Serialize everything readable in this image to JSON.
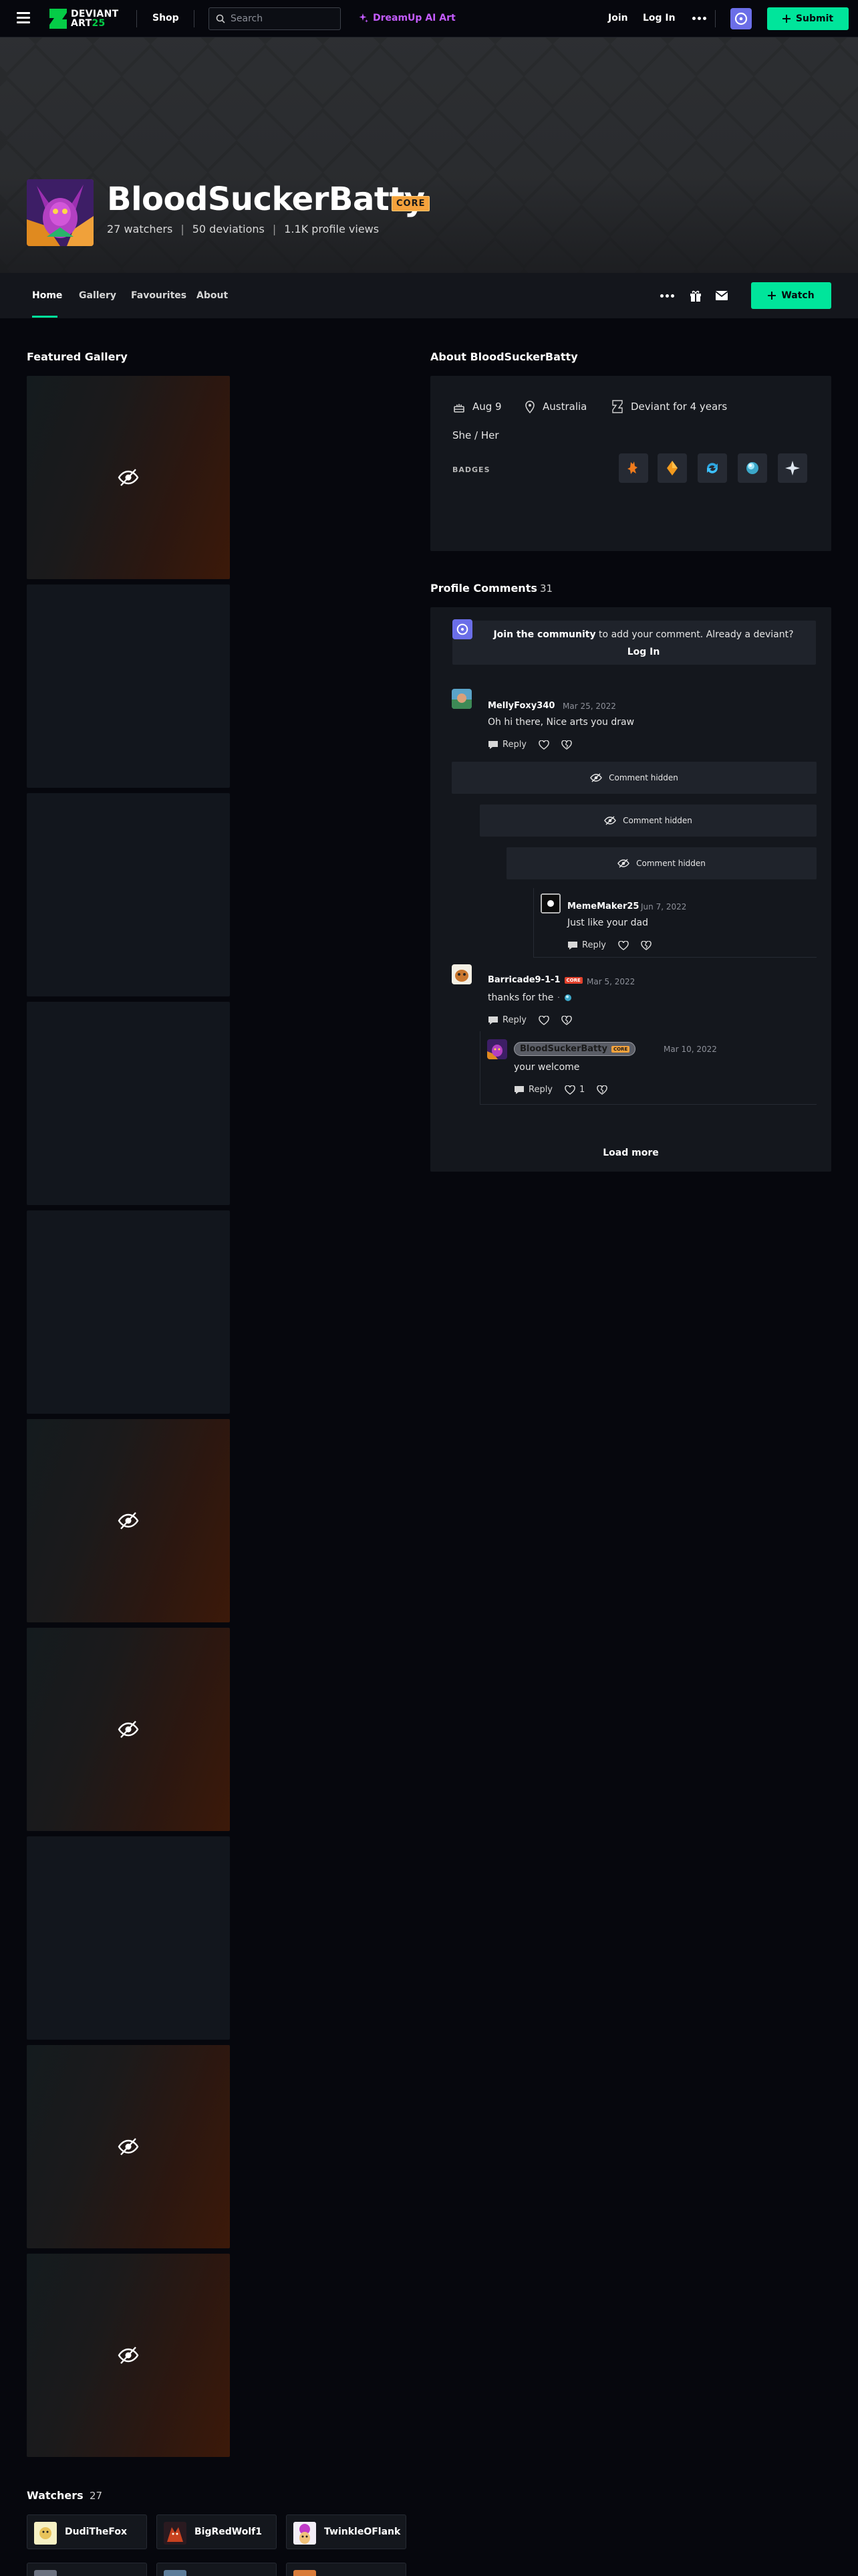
{
  "topnav": {
    "logo_line1": "DEVIANT",
    "logo_line2": "ART",
    "logo_year": "25",
    "shop": "Shop",
    "search_placeholder": "Search",
    "dreamup": "DreamUp AI Art",
    "join": "Join",
    "login": "Log In",
    "submit": "Submit"
  },
  "profile": {
    "username": "BloodSuckerBatty",
    "badge": "CORE",
    "watchers": "27 watchers",
    "deviations": "50 deviations",
    "views": "1.1K profile views"
  },
  "tabs": [
    {
      "label": "Home"
    },
    {
      "label": "Gallery"
    },
    {
      "label": "Favourites"
    },
    {
      "label": "About"
    }
  ],
  "watch_button": "Watch",
  "featured": {
    "title": "Featured Gallery",
    "thumbs": [
      "hidden",
      "plain",
      "plain",
      "plain",
      "plain",
      "hidden",
      "hidden",
      "plain",
      "hidden",
      "hidden"
    ]
  },
  "about": {
    "title": "About BloodSuckerBatty",
    "birthday": "Aug 9",
    "location": "Australia",
    "member": "Deviant for 4 years",
    "pronouns": "She / Her",
    "badges_label": "BADGES"
  },
  "comments": {
    "title": "Profile Comments",
    "count": "31",
    "join_link": "Join the community",
    "join_middle": " to add your comment. Already a deviant? ",
    "login_link": "Log In",
    "hidden_label": "Comment hidden",
    "reply_label": "Reply",
    "items": [
      {
        "user": "MellyFoxy340",
        "date": "Mar 25, 2022",
        "text": "Oh hi there, Nice arts you draw"
      },
      {
        "user": "MemeMaker25",
        "date": "Jun 7, 2022",
        "text": "Just like your dad"
      },
      {
        "user": "Barricade9-1-1",
        "date": "Mar 5, 2022",
        "text": "thanks for the"
      },
      {
        "user": "BloodSuckerBatty",
        "date": "Mar 10, 2022",
        "text": "your welcome",
        "likes": "1"
      }
    ],
    "badge_core": "CORE",
    "load_more": "Load more"
  },
  "watchers": {
    "title": "Watchers",
    "count": "27",
    "list": [
      "DudiTheFox",
      "BigRedWolf1",
      "TwinkleOFlank"
    ]
  },
  "colors": {
    "accent": "#00e59b",
    "core_badge": "#f5a23c",
    "dreamup": "#c45cff",
    "page_bg": "#06070d",
    "panel_bg": "#14171d"
  }
}
